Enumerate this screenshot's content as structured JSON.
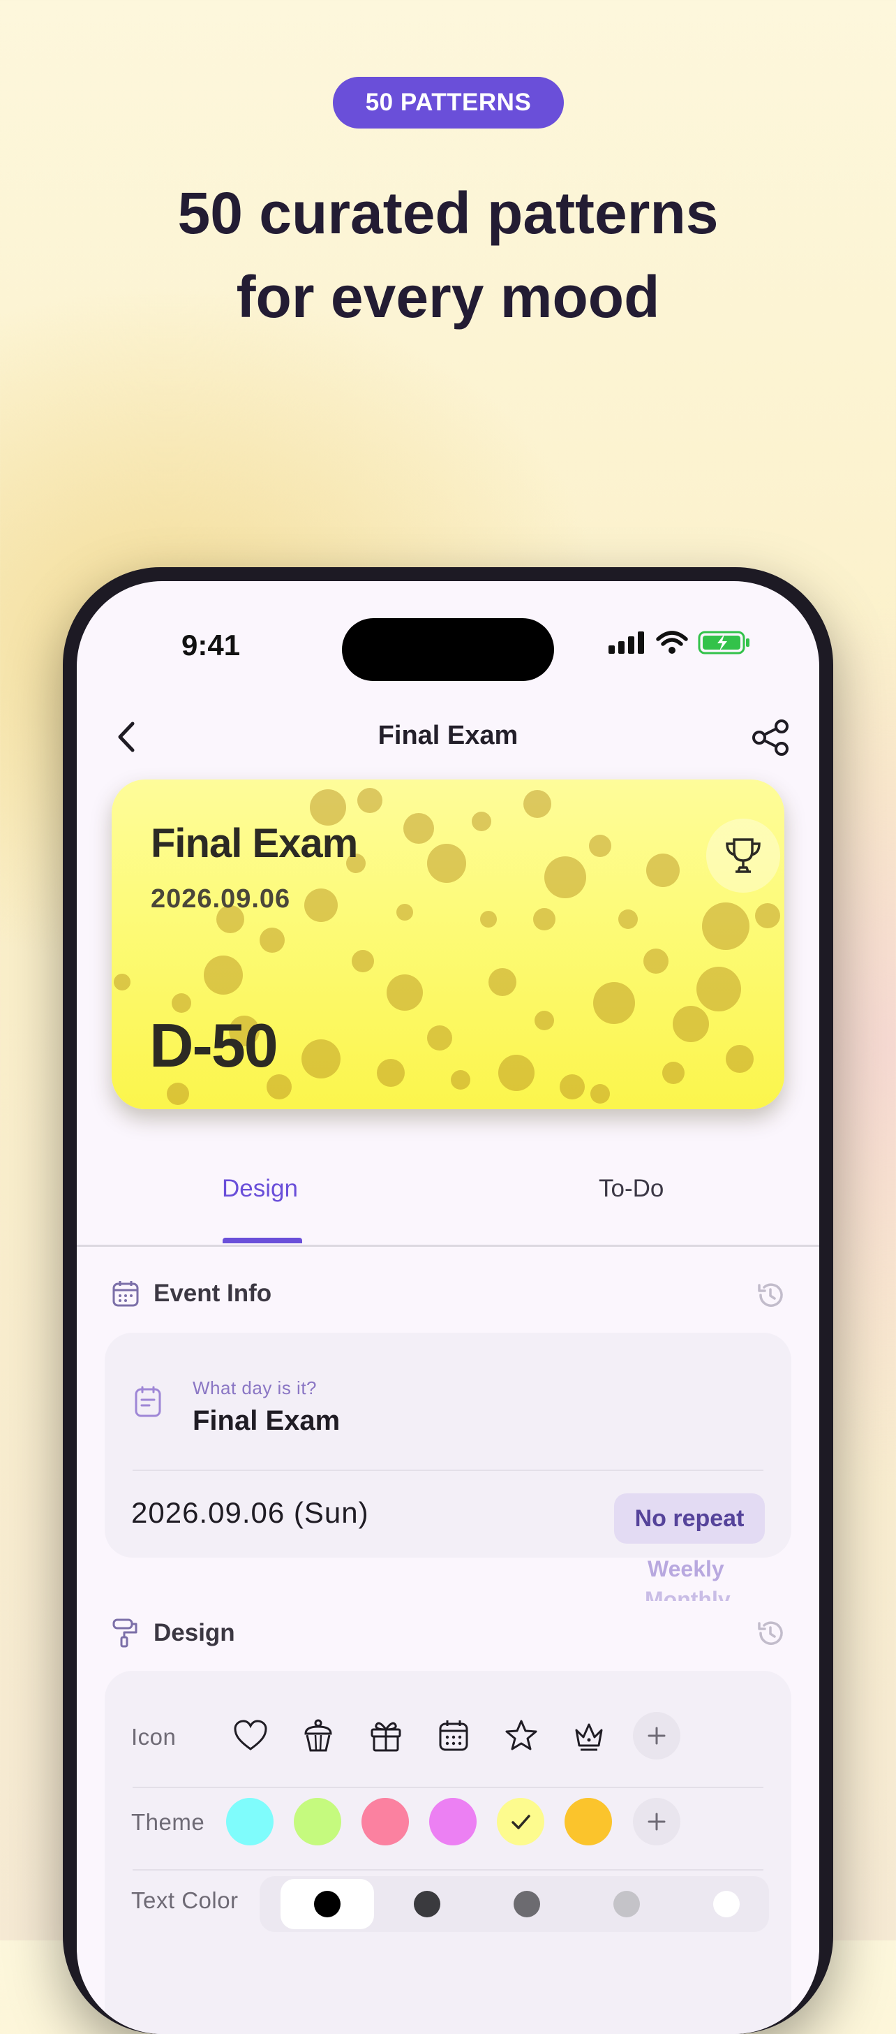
{
  "badge": "50 PATTERNS",
  "headline": {
    "line1": "50 curated patterns",
    "line2": "for every mood"
  },
  "status": {
    "time": "9:41"
  },
  "nav": {
    "title": "Final Exam"
  },
  "card": {
    "title": "Final Exam",
    "date": "2026.09.06",
    "dday": "D-50",
    "icon": "trophy-icon"
  },
  "tabs": {
    "design": "Design",
    "todo": "To-Do",
    "active": "Design"
  },
  "event_info": {
    "heading": "Event Info",
    "field_label": "What day is it?",
    "field_value": "Final Exam",
    "date": "2026.09.06 (Sun)",
    "repeat": "No repeat",
    "repeat_options": [
      "Weekly",
      "Monthly"
    ]
  },
  "design": {
    "heading": "Design",
    "icon_label": "Icon",
    "icons": [
      "heart-icon",
      "cupcake-icon",
      "gift-icon",
      "calendar-icon",
      "star-icon",
      "crown-icon"
    ],
    "theme_label": "Theme",
    "themes": [
      "#7ffcfc",
      "#c5fa7e",
      "#fb81a0",
      "#ec80f3",
      "#fdfb8e",
      "#fbc42c"
    ],
    "theme_selected": "#fdfb8e",
    "text_color_label": "Text Color",
    "text_colors": [
      "#000000",
      "#3a3a3e",
      "#6c6b70",
      "#c4c3c8",
      "#ffffff"
    ]
  },
  "colors": {
    "accent": "#6a4fd9"
  }
}
